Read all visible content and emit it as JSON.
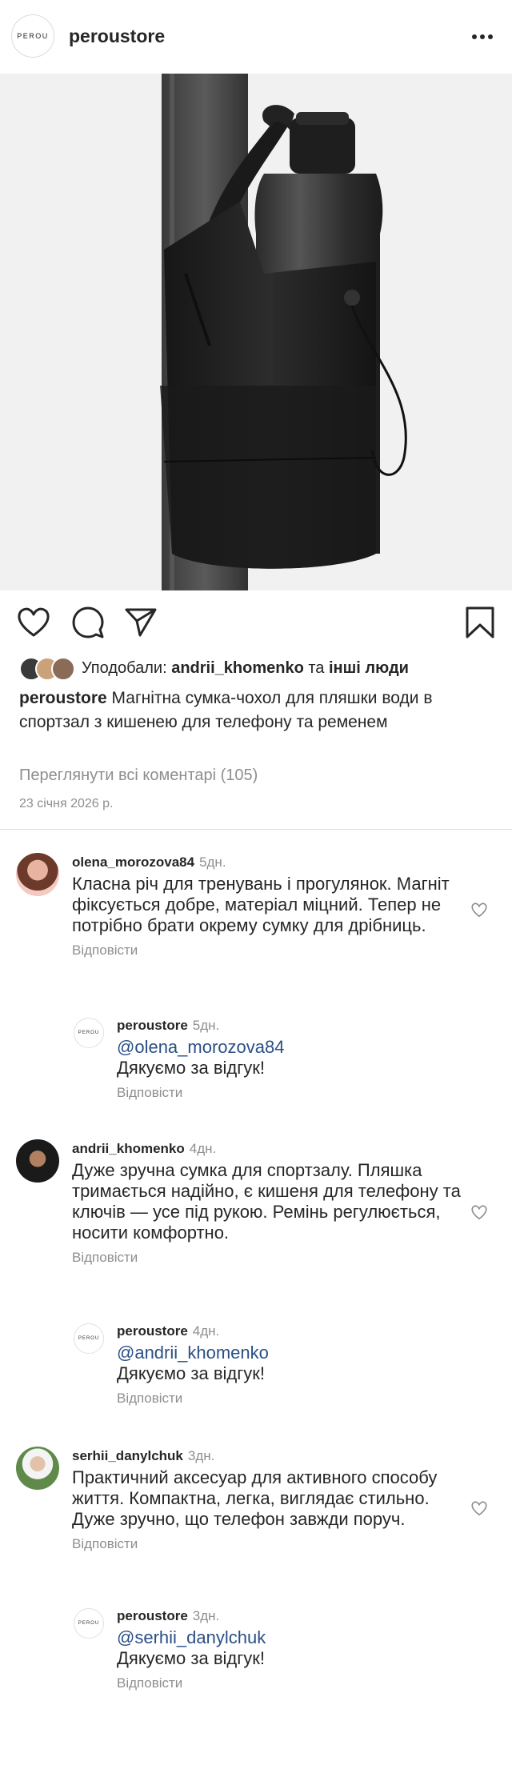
{
  "header": {
    "logo_text": "PEROU",
    "username": "peroustore",
    "more_icon": "more-horizontal-icon"
  },
  "post": {
    "likes_prefix": "Уподобали:",
    "liked_by": "andrii_khomenko",
    "likes_and": "та",
    "likes_others": "інші люди",
    "caption_user": "peroustore",
    "caption_text": "Магнітна сумка-чохол для пляшки води в спортзал з кишенею для телефону та ременем",
    "view_comments": "Переглянути всі коментарі (105)",
    "date": "23 січня 2026 р."
  },
  "comments": [
    {
      "user": "olena_morozova84",
      "time": "5дн.",
      "text": "Класна річ для тренувань і прогулянок. Магніт фіксується добре, матеріал міцний. Тепер не потрібно брати окрему сумку для дрібниць.",
      "reply_label": "Відповісти",
      "reply": {
        "user": "peroustore",
        "time": "5дн.",
        "mention": "@olena_morozova84",
        "text": "Дякуємо за відгук!",
        "reply_label": "Відповісти",
        "logo_text": "PEROU"
      }
    },
    {
      "user": "andrii_khomenko",
      "time": "4дн.",
      "text": "Дуже зручна сумка для спортзалу. Пляшка тримається надійно, є кишеня для телефону та ключів — усе під рукою. Ремінь регулюється, носити комфортно.",
      "reply_label": "Відповісти",
      "reply": {
        "user": "peroustore",
        "time": "4дн.",
        "mention": "@andrii_khomenko",
        "text": "Дякуємо за відгук!",
        "reply_label": "Відповісти",
        "logo_text": "PEROU"
      }
    },
    {
      "user": "serhii_danylchuk",
      "time": "3дн.",
      "text": "Практичний аксесуар для активного способу життя. Компактна, легка, виглядає стильно. Дуже зручно, що телефон завжди поруч.",
      "reply_label": "Відповісти",
      "reply": {
        "user": "peroustore",
        "time": "3дн.",
        "mention": "@serhii_danylchuk",
        "text": "Дякуємо за відгук!",
        "reply_label": "Відповісти",
        "logo_text": "PEROU"
      }
    }
  ]
}
